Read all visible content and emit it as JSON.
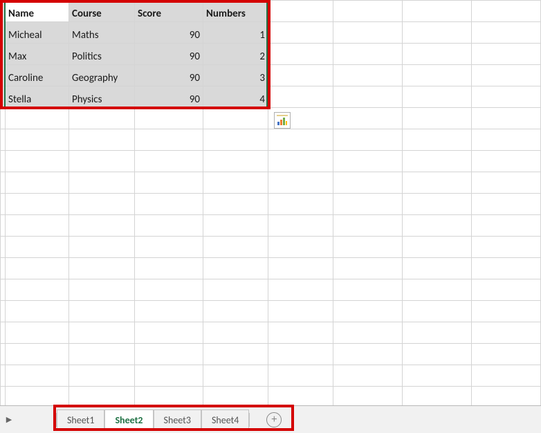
{
  "table": {
    "headers": [
      "Name",
      "Course",
      "Score",
      "Numbers"
    ],
    "rows": [
      {
        "name": "Micheal",
        "course": "Maths",
        "score": 90,
        "numbers": 1
      },
      {
        "name": "Max",
        "course": "Politics",
        "score": 90,
        "numbers": 2
      },
      {
        "name": "Caroline",
        "course": "Geography",
        "score": 90,
        "numbers": 3
      },
      {
        "name": "Stella",
        "course": "Physics",
        "score": 90,
        "numbers": 4
      }
    ]
  },
  "tabs": {
    "items": [
      "Sheet1",
      "Sheet2",
      "Sheet3",
      "Sheet4"
    ],
    "active_index": 1
  },
  "icons": {
    "quick_analysis": "quick-analysis-icon",
    "add_sheet": "plus-icon"
  },
  "chart_data": {
    "type": "table",
    "headers": [
      "Name",
      "Course",
      "Score",
      "Numbers"
    ],
    "rows": [
      [
        "Micheal",
        "Maths",
        90,
        1
      ],
      [
        "Max",
        "Politics",
        90,
        2
      ],
      [
        "Caroline",
        "Geography",
        90,
        3
      ],
      [
        "Stella",
        "Physics",
        90,
        4
      ]
    ]
  }
}
